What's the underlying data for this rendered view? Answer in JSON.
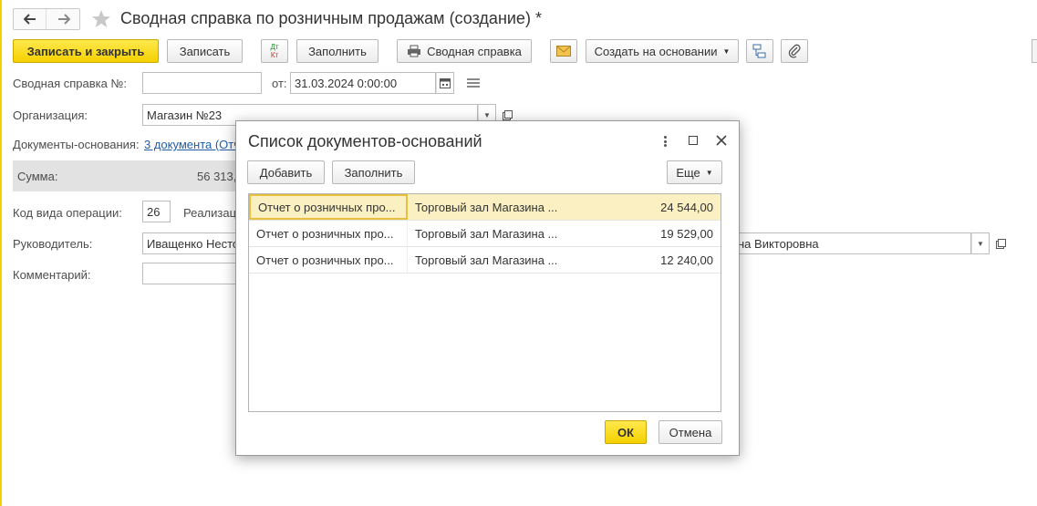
{
  "window": {
    "title": "Сводная справка по розничным продажам (создание) *"
  },
  "toolbar": {
    "save_close": "Записать и закрыть",
    "save": "Записать",
    "dtkt_top": "Дт",
    "dtkt_bottom": "Кт",
    "fill": "Заполнить",
    "print_summary": "Сводная справка",
    "create_based": "Создать на основании"
  },
  "form": {
    "number_label": "Сводная справка №:",
    "number_value": "",
    "date_label": "от:",
    "date_value": "31.03.2024  0:00:00",
    "org_label": "Организация:",
    "org_value": "Магазин №23",
    "basis_label": "Документы-основания:",
    "basis_link": "3 документа (Отч",
    "sum_label": "Сумма:",
    "sum_value": "56 313,",
    "opcode_label": "Код вида операции:",
    "opcode_value": "26",
    "opcode_desc": "Реализац",
    "manager_label": "Руководитель:",
    "manager_value": "Иващенко Несто",
    "manager_value_right": "на Викторовна",
    "comment_label": "Комментарий:",
    "comment_value": ""
  },
  "dialog": {
    "title": "Список документов-оснований",
    "add": "Добавить",
    "fill": "Заполнить",
    "more": "Еще",
    "ok": "ОК",
    "cancel": "Отмена",
    "rows": [
      {
        "doc": "Отчет о розничных про...",
        "store": "Торговый зал Магазина ...",
        "amount": "24 544,00"
      },
      {
        "doc": "Отчет о розничных про...",
        "store": "Торговый зал Магазина ...",
        "amount": "19 529,00"
      },
      {
        "doc": "Отчет о розничных про...",
        "store": "Торговый зал Магазина ...",
        "amount": "12 240,00"
      }
    ]
  },
  "colors": {
    "accent_yellow": "#f5d000",
    "selected_row": "#fbf0c2",
    "link": "#1f5ea8"
  }
}
